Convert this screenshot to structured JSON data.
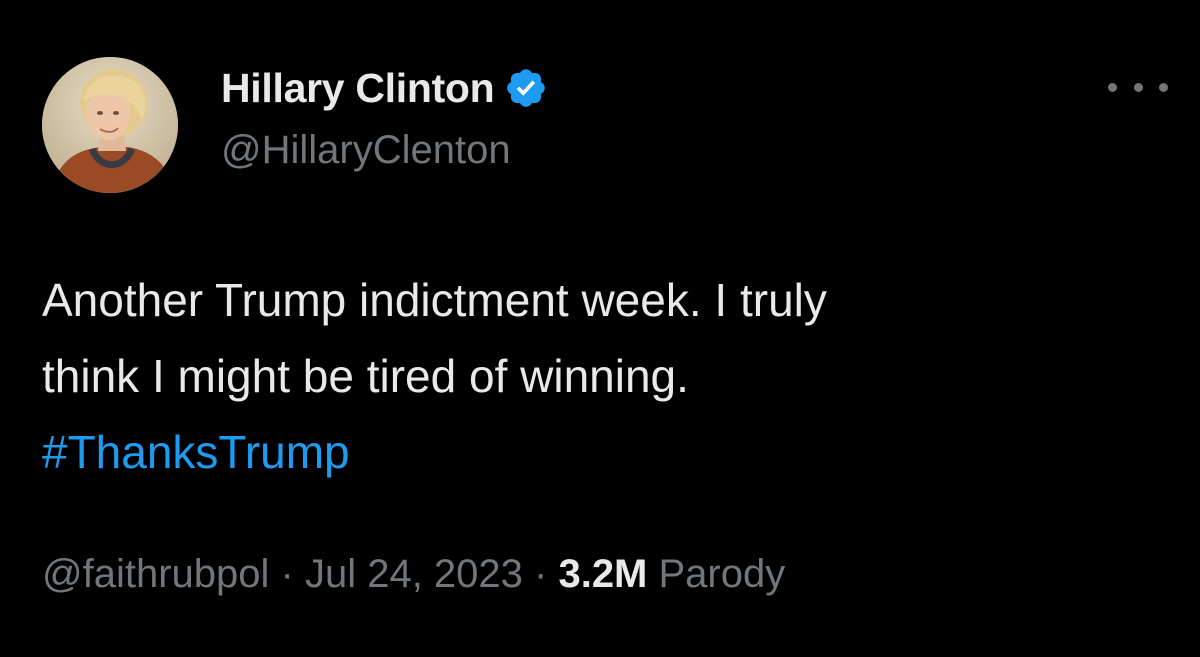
{
  "author": {
    "display_name": "Hillary Clinton",
    "handle": "@HillaryClenton",
    "verified_icon": "verified-badge-icon",
    "verified_color": "#1d9bf0"
  },
  "tweet": {
    "text_line_1": "Another Trump indictment week. I truly",
    "text_line_2": "think I might be tired of winning.",
    "hashtag": "#ThanksTrump"
  },
  "meta": {
    "source_handle": "@faithrubpol",
    "separator_1": " · ",
    "date": "Jul 24, 2023",
    "separator_2": " · ",
    "views": "3.2M",
    "label": " Parody"
  },
  "actions": {
    "more_icon": "more-horizontal-icon"
  },
  "colors": {
    "background": "#000000",
    "primary_text": "#e7e9ea",
    "secondary_text": "#71767b",
    "link": "#1d9bf0"
  }
}
